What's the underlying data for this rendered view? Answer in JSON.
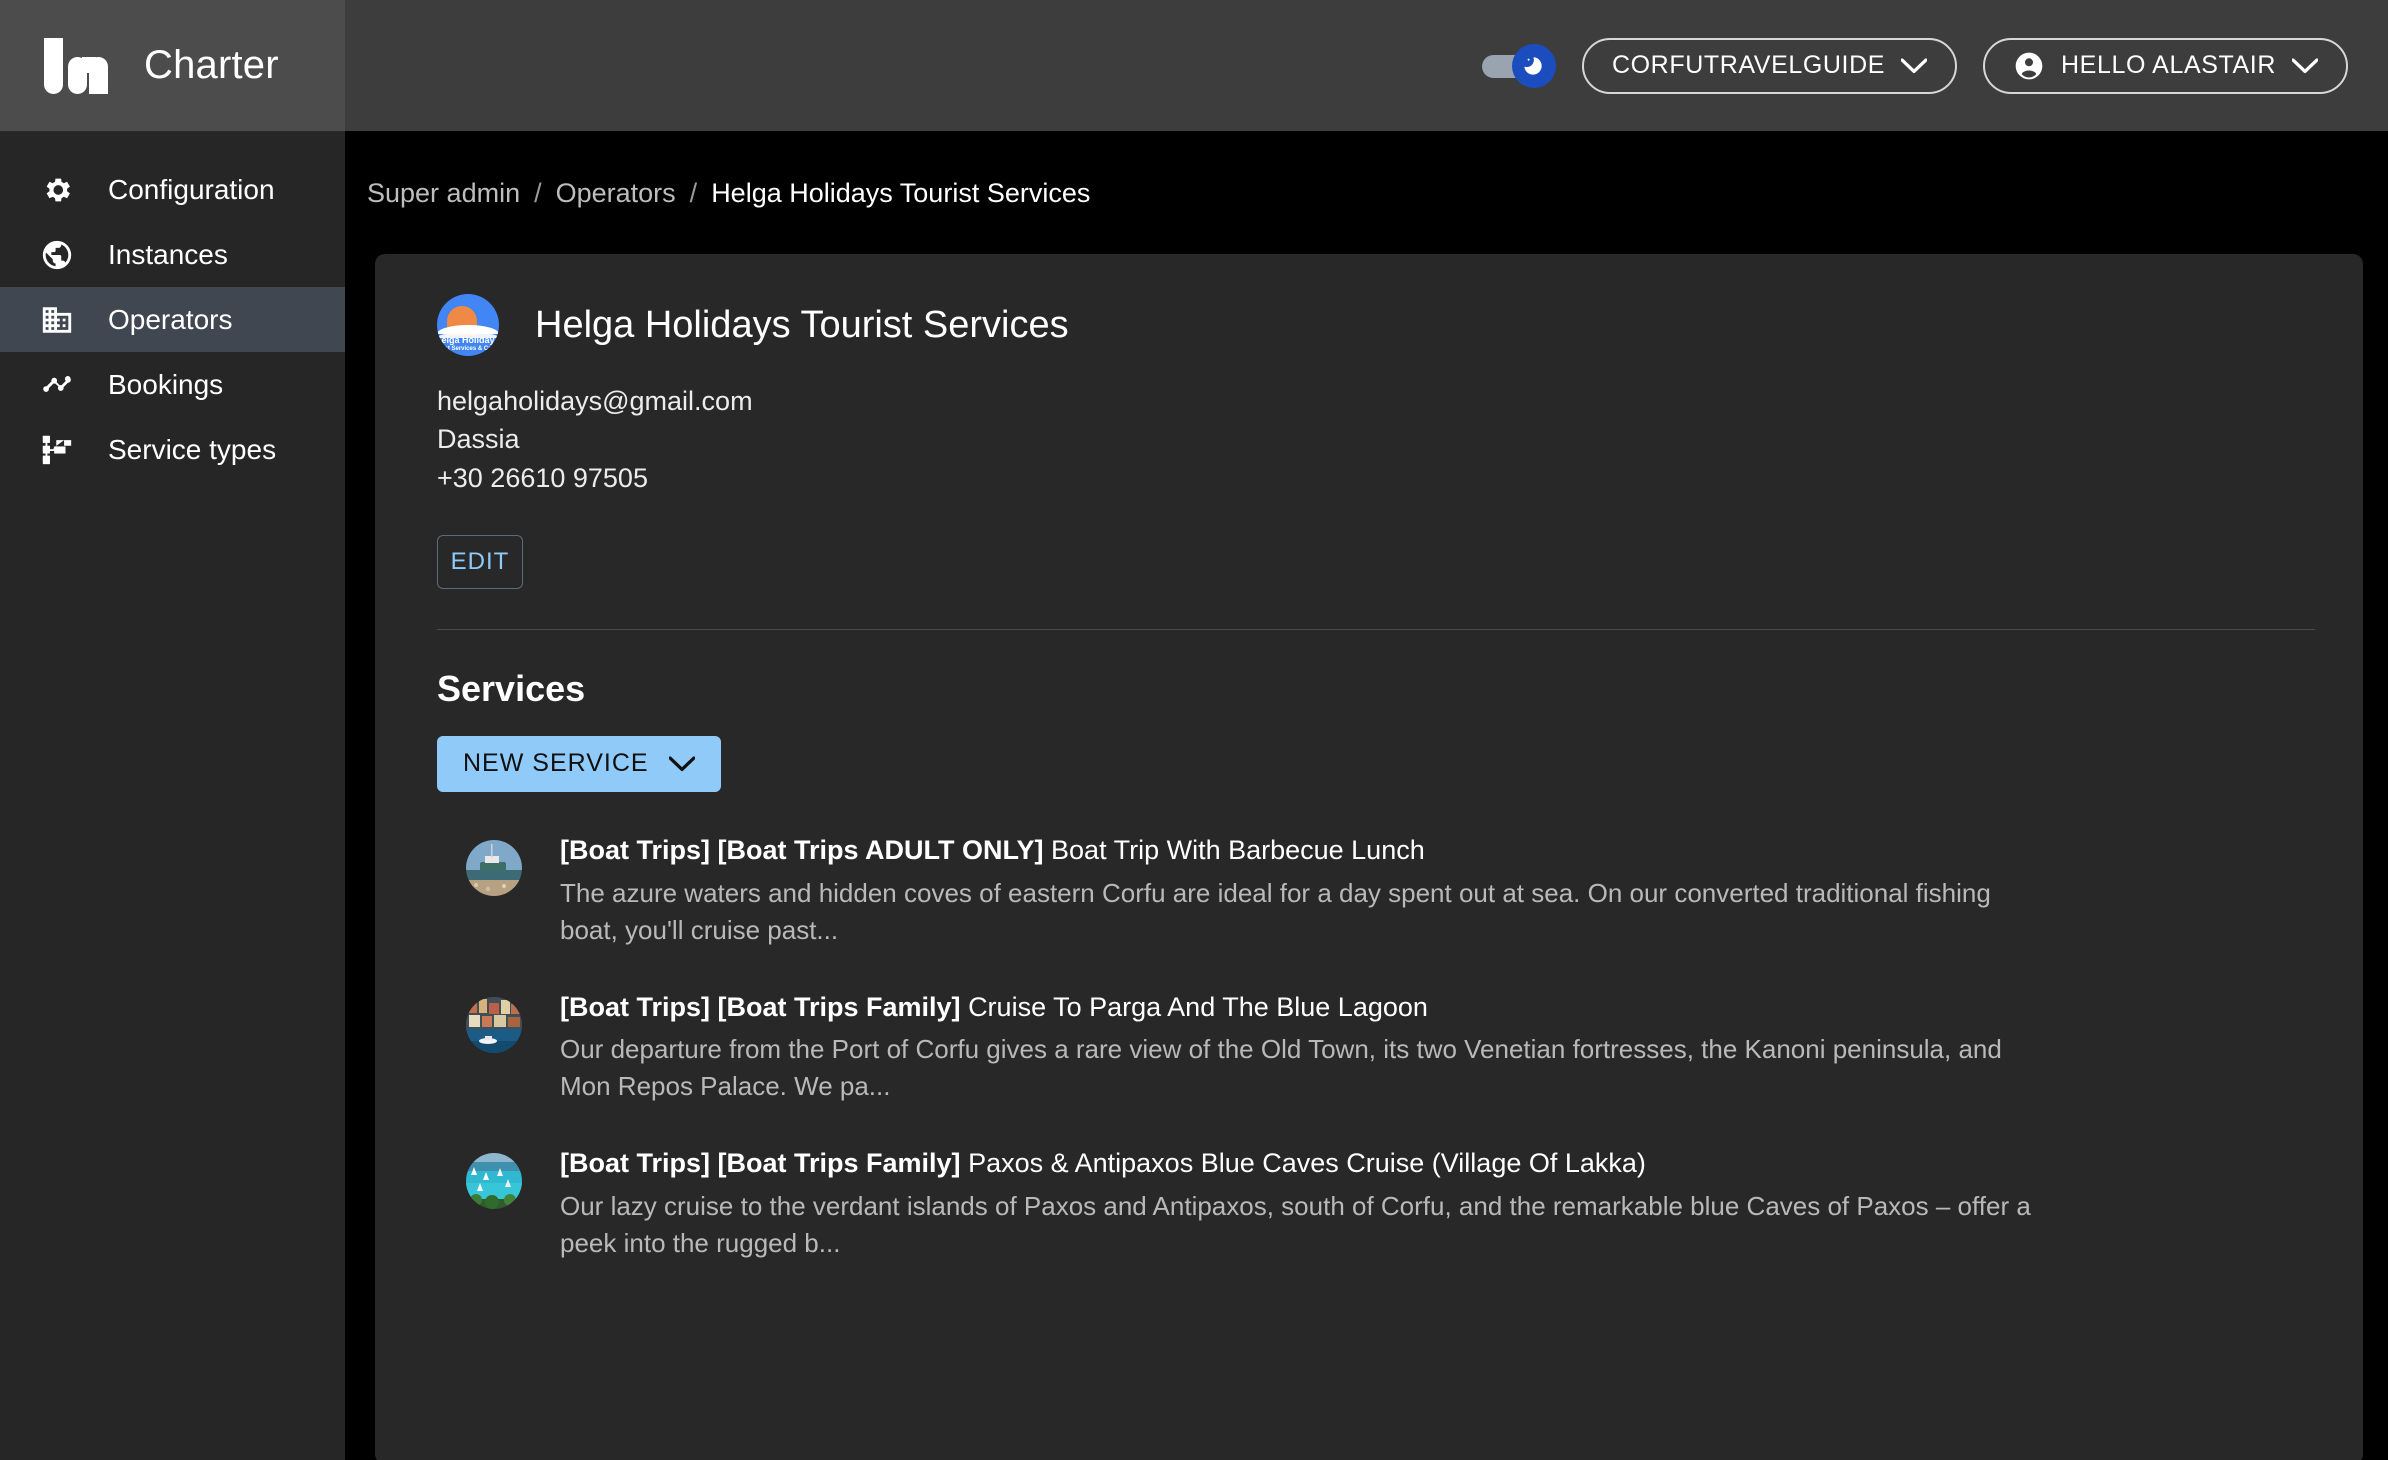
{
  "brand": {
    "title": "Charter",
    "logo_icon": "charter-bars-logo"
  },
  "topbar": {
    "theme_toggle": {
      "icon": "moon-icon",
      "state": "dark",
      "accent": "#1b4dbf"
    },
    "instance_selector": {
      "label": "CORFUTRAVELGUIDE",
      "chevron_icon": "chevron-down-icon"
    },
    "user_menu": {
      "label": "HELLO ALASTAIR",
      "avatar_icon": "account-circle-icon",
      "chevron_icon": "chevron-down-icon"
    }
  },
  "sidebar": {
    "items": [
      {
        "label": "Configuration",
        "icon": "gear-icon",
        "active": false
      },
      {
        "label": "Instances",
        "icon": "globe-icon",
        "active": false
      },
      {
        "label": "Operators",
        "icon": "building-icon",
        "active": true
      },
      {
        "label": "Bookings",
        "icon": "timeline-chart-icon",
        "active": false
      },
      {
        "label": "Service types",
        "icon": "account-tree-icon",
        "active": false
      }
    ]
  },
  "breadcrumb": [
    {
      "label": "Super admin",
      "current": false
    },
    {
      "label": "Operators",
      "current": false
    },
    {
      "label": "Helga Holidays Tourist Services",
      "current": true
    }
  ],
  "operator": {
    "name": "Helga Holidays Tourist Services",
    "avatar_icon": "helga-holidays-logo",
    "avatar_text_line1": "elga Holiday",
    "avatar_text_line2": "st Services & Ca",
    "email": "helgaholidays@gmail.com",
    "location": "Dassia",
    "phone": "+30 26610 97505",
    "edit_label": "EDIT"
  },
  "services": {
    "heading": "Services",
    "new_button": {
      "label": "NEW SERVICE",
      "chevron_icon": "chevron-down-icon"
    },
    "items": [
      {
        "tags": "[Boat Trips] [Boat Trips ADULT ONLY]",
        "name": "Boat Trip With Barbecue Lunch",
        "description": "The azure waters and hidden coves of eastern Corfu are ideal for a day spent out at sea. On our converted traditional fishing boat, you'll cruise past...",
        "thumb_icon": "boat-on-beach-thumbnail"
      },
      {
        "tags": "[Boat Trips] [Boat Trips Family]",
        "name": "Cruise To Parga And The Blue Lagoon",
        "description": "Our departure from the Port of Corfu gives a rare view of the Old Town, its two Venetian fortresses, the Kanoni peninsula, and Mon Repos Palace. We pa...",
        "thumb_icon": "coastal-town-thumbnail"
      },
      {
        "tags": "[Boat Trips] [Boat Trips Family]",
        "name": "Paxos & Antipaxos Blue Caves Cruise (Village Of Lakka)",
        "description": "Our lazy cruise to the verdant islands of Paxos and Antipaxos, south of Corfu, and the remarkable blue Caves of Paxos – offer a peek into the rugged b...",
        "thumb_icon": "turquoise-bay-thumbnail"
      }
    ]
  },
  "colors": {
    "accent_blue": "#90caf9",
    "sidebar_bg": "#262626",
    "sidebar_active": "#404751",
    "card_bg": "#282828",
    "topbar_bg": "#3d3d3d",
    "brand_bg": "#4c4c4c"
  }
}
